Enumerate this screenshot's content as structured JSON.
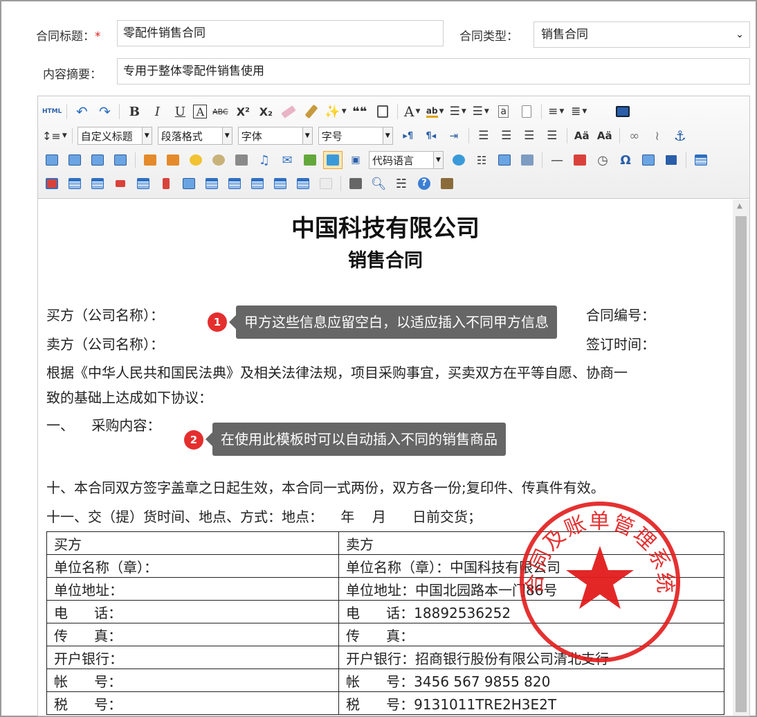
{
  "form": {
    "title_label": "合同标题：",
    "required_mark": "*",
    "title_value": "零配件销售合同",
    "type_label": "合同类型：",
    "type_value": "销售合同",
    "summary_label": "内容摘要：",
    "summary_value": "专用于整体零配件销售使用"
  },
  "toolbar": {
    "html_label": "HTML",
    "bold": "B",
    "italic": "I",
    "underline": "U",
    "border_a": "A",
    "strike": "ABC",
    "superscript": "X²",
    "subscript": "X₂",
    "quote": "❝❝",
    "font_color": "A",
    "combo_heading": "自定义标题",
    "combo_paragraph": "段落格式",
    "combo_font": "字体",
    "combo_size": "字号",
    "combo_code": "代码语言",
    "omega": "Ω"
  },
  "doc": {
    "company": "中国科技有限公司",
    "subtitle": "销售合同",
    "buyer1": "买方（公司名称）：",
    "buyer2": "卖方（公司名称）：",
    "contract_no": "合同编号：",
    "sign_time": "签订时间：",
    "para1": "根据《中华人民共和国民法典》及相关法律法规，项目采购事宜，买卖双方在平等自愿、协商一",
    "para2": "致的基础上达成如下协议：",
    "section1": "一、    采购内容：",
    "section10": "十、本合同双方签字盖章之日起生效，本合同一式两份，双方各一份;复印件、传真件有效。",
    "section11": "十一、交（提）货时间、地点、方式：地点：    年    月      日前交货；"
  },
  "tips": [
    {
      "num": "1",
      "text": "甲方这些信息应留空白，以适应插入不同甲方信息"
    },
    {
      "num": "2",
      "text": "在使用此模板时可以自动插入不同的销售商品"
    }
  ],
  "table": {
    "rows": [
      [
        "买方",
        "卖方"
      ],
      [
        "单位名称（章）：",
        "单位名称（章）：中国科技有限公司"
      ],
      [
        "单位地址：",
        "单位地址：中国北园路本一门86号"
      ],
      [
        "电      话：",
        "电      话：18892536252"
      ],
      [
        "传      真：",
        "传      真："
      ],
      [
        "开户银行：",
        "开户银行：招商银行股份有限公司清北支行"
      ],
      [
        "帐      号：",
        "帐      号：3456 567 9855 820"
      ],
      [
        "税      号：",
        "税      号：9131011TRE2H3E2T"
      ]
    ]
  },
  "stamp": {
    "text": "合同及账单管理系统",
    "color": "#e21b1b"
  }
}
